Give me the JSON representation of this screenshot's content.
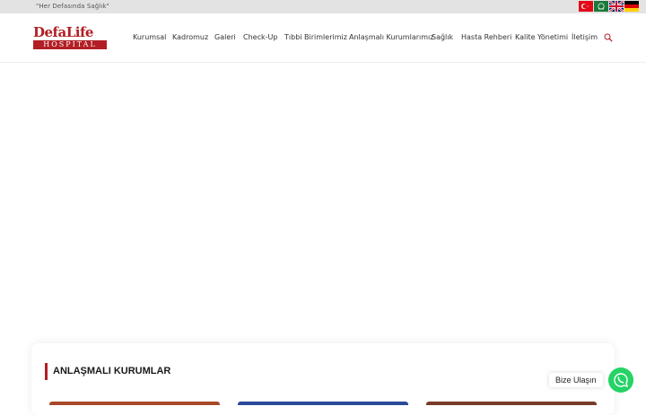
{
  "topbar": {
    "slogan": "\"Her Defasında Sağlık\"",
    "languages": [
      "tr-flag",
      "ar-flag",
      "en-flag",
      "de-flag"
    ]
  },
  "logo": {
    "main": "DefaLife",
    "sub": "HOSPITAL",
    "color": "#b21e24"
  },
  "nav": {
    "items": [
      "Kurumsal",
      "Kadromuz",
      "Galeri",
      "Check-Up",
      "Tıbbi Birimlerimiz",
      "Anlaşmalı Kurumlarımız",
      "Sağlık",
      "Hasta Rehberi",
      "Kalite Yönetimi",
      "İletişim"
    ]
  },
  "section": {
    "title": "ANLAŞMALI KURUMLAR",
    "accent": "#b21e24"
  },
  "contact": {
    "label": "Bize Ulaşın",
    "button_color": "#25d366"
  }
}
